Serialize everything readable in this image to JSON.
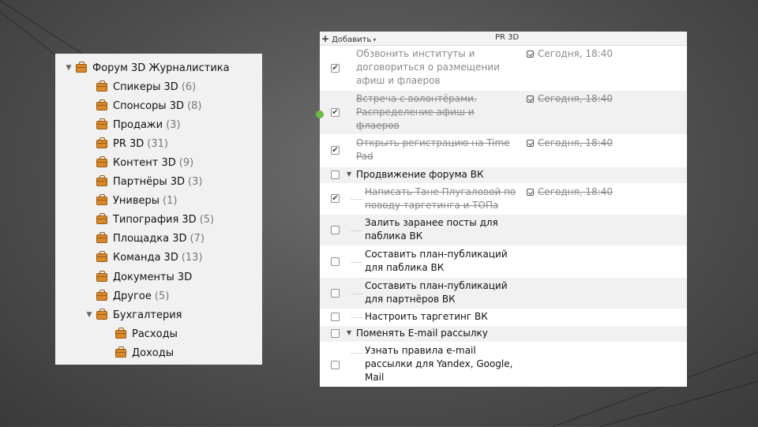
{
  "tree": {
    "root": {
      "label": "Форум 3D Журналистика"
    },
    "items": [
      {
        "label": "Спикеры 3D",
        "count": "(6)"
      },
      {
        "label": "Спонсоры 3D",
        "count": "(8)"
      },
      {
        "label": "Продажи",
        "count": "(3)"
      },
      {
        "label": "PR 3D",
        "count": "(31)"
      },
      {
        "label": "Контент 3D",
        "count": "(9)"
      },
      {
        "label": "Партнёры 3D",
        "count": "(3)"
      },
      {
        "label": "Универы",
        "count": "(1)"
      },
      {
        "label": "Типография 3D",
        "count": "(5)"
      },
      {
        "label": "Площадка 3D",
        "count": "(7)"
      },
      {
        "label": "Команда 3D",
        "count": "(13)"
      },
      {
        "label": "Документы 3D",
        "count": ""
      },
      {
        "label": "Другое",
        "count": "(5)"
      },
      {
        "label": "Бухгалтерия",
        "count": ""
      }
    ],
    "subitems": [
      {
        "label": "Расходы"
      },
      {
        "label": "Доходы"
      }
    ]
  },
  "toolbar": {
    "add_label": "Добавить",
    "project_label": "PR 3D"
  },
  "tasks": [
    {
      "line1": "Обзвонить институты и",
      "line2": "договориться о размещении",
      "line3": "афиш и флаеров",
      "checked": "✔",
      "due": "Сегодня, 18:40"
    },
    {
      "line1": "Встреча с волонтёрами.",
      "line2": "Распределение афиш и",
      "line3": "флаеров",
      "checked": "✔",
      "due": "Сегодня, 18:40"
    },
    {
      "line1": "Открыть регистрацию на Time",
      "line2": "Pad",
      "checked": "✔",
      "due": "Сегодня, 18:40"
    },
    {
      "line1": "Продвижение форума ВК",
      "checked": ""
    },
    {
      "line1": "Написать Тане Плугаловой по",
      "line2": "поводу таргетинга и ТОПа",
      "checked": "✔",
      "due": "Сегодня, 18:40"
    },
    {
      "line1": "Залить заранее посты для",
      "line2": "паблика ВК",
      "checked": ""
    },
    {
      "line1": "Составить план-публикаций",
      "line2": "для паблика ВК",
      "checked": ""
    },
    {
      "line1": "Составить план-публикаций",
      "line2": "для партнёров ВК",
      "checked": ""
    },
    {
      "line1": "Настроить таргетинг ВК",
      "checked": ""
    },
    {
      "line1": "Поменять E-mail рассылку",
      "checked": ""
    },
    {
      "line1": "Узнать правила e-mail",
      "line2": "рассылки для Yandex, Google,",
      "line3": "Mail",
      "checked": ""
    }
  ]
}
